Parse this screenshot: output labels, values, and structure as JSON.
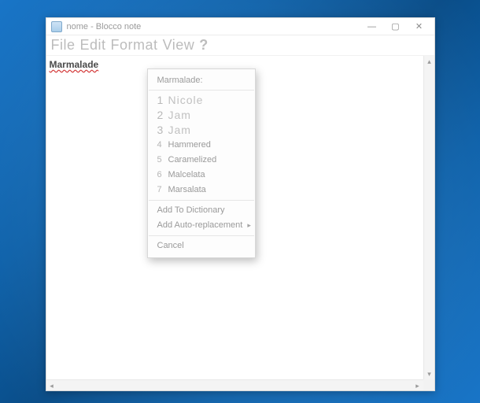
{
  "window": {
    "title": "nome - Blocco note"
  },
  "menubar": {
    "file": "File",
    "edit": "Edit",
    "format": "Format",
    "view": "View",
    "help": "?"
  },
  "editor": {
    "word": "Marmalade"
  },
  "context_menu": {
    "header": "Marmalade:",
    "suggestions": [
      {
        "n": "1",
        "label": "Nicole",
        "big": true
      },
      {
        "n": "2",
        "label": "Jam",
        "big": true
      },
      {
        "n": "3",
        "label": "Jam",
        "big": true
      },
      {
        "n": "4",
        "label": "Hammered",
        "big": false
      },
      {
        "n": "5",
        "label": "Caramelized",
        "big": false
      },
      {
        "n": "6",
        "label": "Malcelata",
        "big": false
      },
      {
        "n": "7",
        "label": "Marsalata",
        "big": false
      }
    ],
    "add_dict": "Add To Dictionary",
    "add_auto": "Add Auto-replacement",
    "cancel": "Cancel"
  },
  "win_buttons": {
    "min": "—",
    "max": "▢",
    "close": "✕"
  },
  "scroll_glyphs": {
    "up": "▴",
    "down": "▾",
    "left": "◂",
    "right": "▸"
  }
}
